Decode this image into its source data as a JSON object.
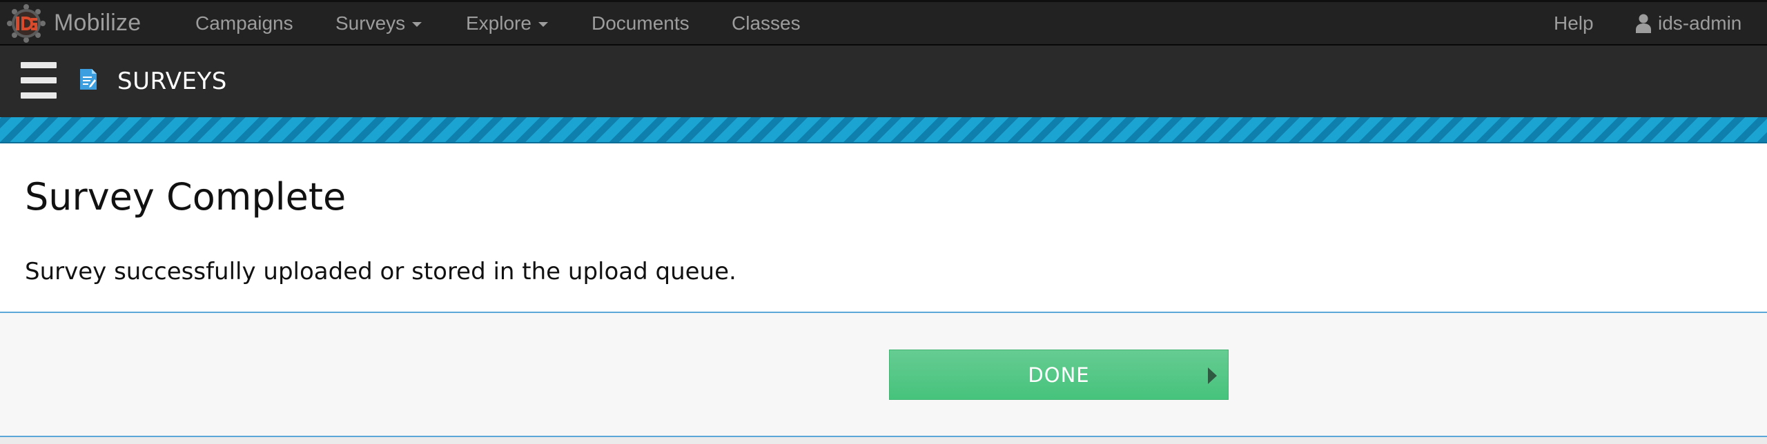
{
  "navbar": {
    "brand_name": "Mobilize",
    "logo_icon": "ids-gear-logo-icon",
    "links": [
      {
        "label": "Campaigns",
        "has_dropdown": false
      },
      {
        "label": "Surveys",
        "has_dropdown": true
      },
      {
        "label": "Explore",
        "has_dropdown": true
      },
      {
        "label": "Documents",
        "has_dropdown": false
      },
      {
        "label": "Classes",
        "has_dropdown": false
      }
    ],
    "help_label": "Help",
    "user_icon": "user-icon",
    "user_name": "ids-admin"
  },
  "page_header": {
    "menu_icon": "hamburger-menu-icon",
    "section_icon": "survey-document-icon",
    "title": "SURVEYS"
  },
  "content": {
    "heading": "Survey Complete",
    "message": "Survey successfully uploaded or stored in the upload queue."
  },
  "footer": {
    "done_label": "DONE",
    "done_icon": "play-arrow-icon"
  },
  "colors": {
    "navbar_bg": "#222222",
    "header_bg": "#2a2a2a",
    "stripe_accent": "#1595c3",
    "done_button": "#4cc581",
    "divider": "#5aa7d8"
  }
}
